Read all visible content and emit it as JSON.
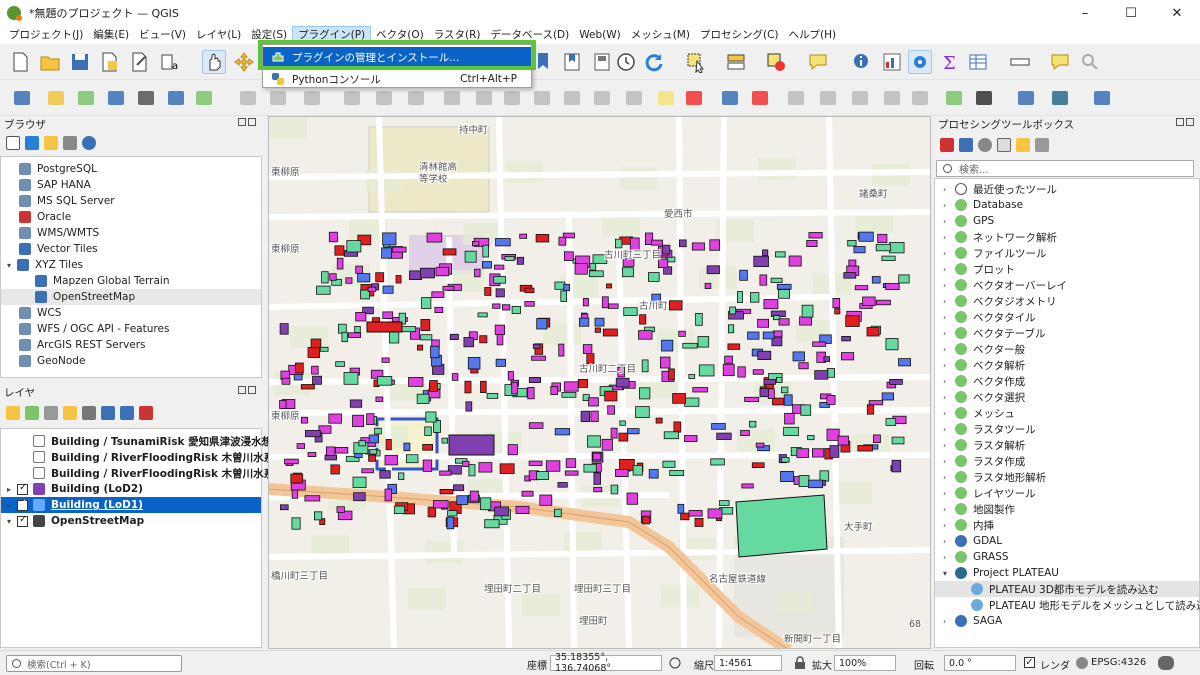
{
  "window": {
    "title": "*無題のプロジェクト — QGIS"
  },
  "menubar": [
    "プロジェクト(J)",
    "編集(E)",
    "ビュー(V)",
    "レイヤ(L)",
    "設定(S)",
    "プラグイン(P)",
    "ベクタ(O)",
    "ラスタ(R)",
    "データベース(D)",
    "Web(W)",
    "メッシュ(M)",
    "プロセシング(C)",
    "ヘルプ(H)"
  ],
  "plugin_menu": {
    "items": [
      {
        "label": "プラグインの管理とインストール...",
        "shortcut": ""
      },
      {
        "label": "Pythonコンソール",
        "shortcut": "Ctrl+Alt+P"
      }
    ]
  },
  "browser": {
    "title": "ブラウザ",
    "items": [
      {
        "label": "PostgreSQL",
        "icon": "postgresql-icon",
        "indent": 0
      },
      {
        "label": "SAP HANA",
        "icon": "sap-hana-icon",
        "indent": 0
      },
      {
        "label": "MS SQL Server",
        "icon": "mssql-icon",
        "indent": 0
      },
      {
        "label": "Oracle",
        "icon": "oracle-icon",
        "indent": 0
      },
      {
        "label": "WMS/WMTS",
        "icon": "globe-icon",
        "indent": 0
      },
      {
        "label": "Vector Tiles",
        "icon": "vector-tiles-icon",
        "indent": 0
      },
      {
        "label": "XYZ Tiles",
        "icon": "xyz-tiles-icon",
        "indent": 0
      },
      {
        "label": "Mapzen Global Terrain",
        "icon": "grid-icon",
        "indent": 1
      },
      {
        "label": "OpenStreetMap",
        "icon": "grid-icon",
        "indent": 1
      },
      {
        "label": "WCS",
        "icon": "globe-icon",
        "indent": 0
      },
      {
        "label": "WFS / OGC API - Features",
        "icon": "globe-icon",
        "indent": 0
      },
      {
        "label": "ArcGIS REST Servers",
        "icon": "arcgis-icon",
        "indent": 0
      },
      {
        "label": "GeoNode",
        "icon": "geonode-icon",
        "indent": 0
      }
    ]
  },
  "layers": {
    "title": "レイヤ",
    "items": [
      {
        "label": "Building / TsunamiRisk 愛知県津波浸水想定",
        "checked": false,
        "icon": "table-icon",
        "selected": false
      },
      {
        "label": "Building / RiverFloodingRisk 木曽川水系木",
        "checked": false,
        "icon": "table-icon",
        "selected": false
      },
      {
        "label": "Building / RiverFloodingRisk 木曽川水系木",
        "checked": false,
        "icon": "table-icon",
        "selected": false
      },
      {
        "label": "Building (LoD2)",
        "checked": true,
        "icon": "polygon-icon",
        "selected": false
      },
      {
        "label": "Building (LoD1)",
        "checked": true,
        "icon": "polygon-icon",
        "selected": true
      },
      {
        "label": "OpenStreetMap",
        "checked": true,
        "icon": "raster-icon",
        "selected": false
      }
    ]
  },
  "processing": {
    "title": "プロセシングツールボックス",
    "search_placeholder": "検索...",
    "items": [
      {
        "label": "最近使ったツール",
        "indent": 0
      },
      {
        "label": "Database",
        "indent": 0
      },
      {
        "label": "GPS",
        "indent": 0
      },
      {
        "label": "ネットワーク解析",
        "indent": 0
      },
      {
        "label": "ファイルツール",
        "indent": 0
      },
      {
        "label": "プロット",
        "indent": 0
      },
      {
        "label": "ベクタオーバーレイ",
        "indent": 0
      },
      {
        "label": "ベクタジオメトリ",
        "indent": 0
      },
      {
        "label": "ベクタタイル",
        "indent": 0
      },
      {
        "label": "ベクタテーブル",
        "indent": 0
      },
      {
        "label": "ベクター般",
        "indent": 0
      },
      {
        "label": "ベクタ解析",
        "indent": 0
      },
      {
        "label": "ベクタ作成",
        "indent": 0
      },
      {
        "label": "ベクタ選択",
        "indent": 0
      },
      {
        "label": "メッシュ",
        "indent": 0
      },
      {
        "label": "ラスタツール",
        "indent": 0
      },
      {
        "label": "ラスタ解析",
        "indent": 0
      },
      {
        "label": "ラスタ作成",
        "indent": 0
      },
      {
        "label": "ラスタ地形解析",
        "indent": 0
      },
      {
        "label": "レイヤツール",
        "indent": 0
      },
      {
        "label": "地図製作",
        "indent": 0
      },
      {
        "label": "内挿",
        "indent": 0
      },
      {
        "label": "GDAL",
        "indent": 0
      },
      {
        "label": "GRASS",
        "indent": 0
      },
      {
        "label": "Project PLATEAU",
        "indent": 0
      },
      {
        "label": "PLATEAU 3D都市モデルを読み込む",
        "indent": 1
      },
      {
        "label": "PLATEAU 地形モデルをメッシュとして読み込む",
        "indent": 1
      },
      {
        "label": "SAGA",
        "indent": 0
      }
    ]
  },
  "map": {
    "labels": [
      "持中町",
      "清林館高",
      "等学校",
      "諸桑町",
      "愛西市",
      "古川町三丁目",
      "東柳原",
      "東柳原",
      "古川町",
      "古川町二丁目",
      "東柳原",
      "埋田町二丁目",
      "埋田町三丁目",
      "埋田町",
      "新開町一丁目",
      "大手町",
      "名古屋鉄道線",
      "68",
      "橋川町三丁目"
    ]
  },
  "status": {
    "search_placeholder": "検索(Ctrl + K)",
    "coord_label": "座標",
    "coord_value": "35.18355°, 136.74068°",
    "scale_label": "縮尺",
    "scale_value": "1:4561",
    "magnifier_label": "拡大",
    "magnifier_value": "100%",
    "rotation_label": "回転",
    "rotation_value": "0.0 °",
    "render_label": "レンダ",
    "crs": "EPSG:4326"
  },
  "colors": {
    "accent": "#0a64c8",
    "highlight_box": "#5ec23a",
    "building_magenta": "#e040e0",
    "building_green": "#66d9a0",
    "building_red": "#e02020",
    "building_blue": "#5577ee",
    "building_purple": "#8040b0"
  }
}
